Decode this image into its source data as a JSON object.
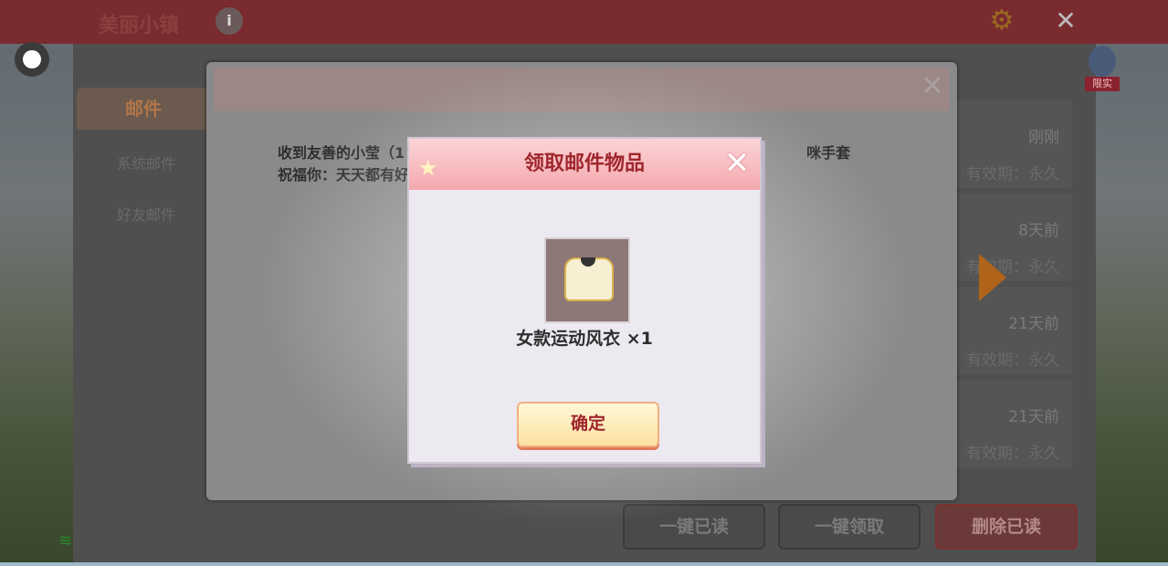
{
  "header": {
    "title": "美丽小镇",
    "info_icon": "info-icon",
    "gear_icon": "gear-icon",
    "close_icon": "close-icon"
  },
  "sidebar": {
    "active_tab": "邮件",
    "items": [
      "系统邮件",
      "好友邮件"
    ]
  },
  "right_badge": "限实",
  "mail_list": [
    {
      "time": "刚刚",
      "valid": "有效期：永久"
    },
    {
      "time": "8天前",
      "valid": "有效期：永久"
    },
    {
      "time": "21天前",
      "valid": "有效期：永久"
    },
    {
      "time": "21天前",
      "valid": "有效期：永久"
    }
  ],
  "bottom_buttons": {
    "read_all": "一键已读",
    "claim_all": "一键领取",
    "delete_read": "删除已读"
  },
  "mail_detail": {
    "line1": "收到友善的小莹（1",
    "line1_tail": "咪手套",
    "line2": "祝福你：天天都有好"
  },
  "popup": {
    "title": "领取邮件物品",
    "item_name": "女款运动风衣 ×1",
    "ok_label": "确定"
  },
  "colors": {
    "title_red": "#a0262e",
    "popup_bg": "#eceaf0",
    "header_pink": "#f4a9ae"
  }
}
